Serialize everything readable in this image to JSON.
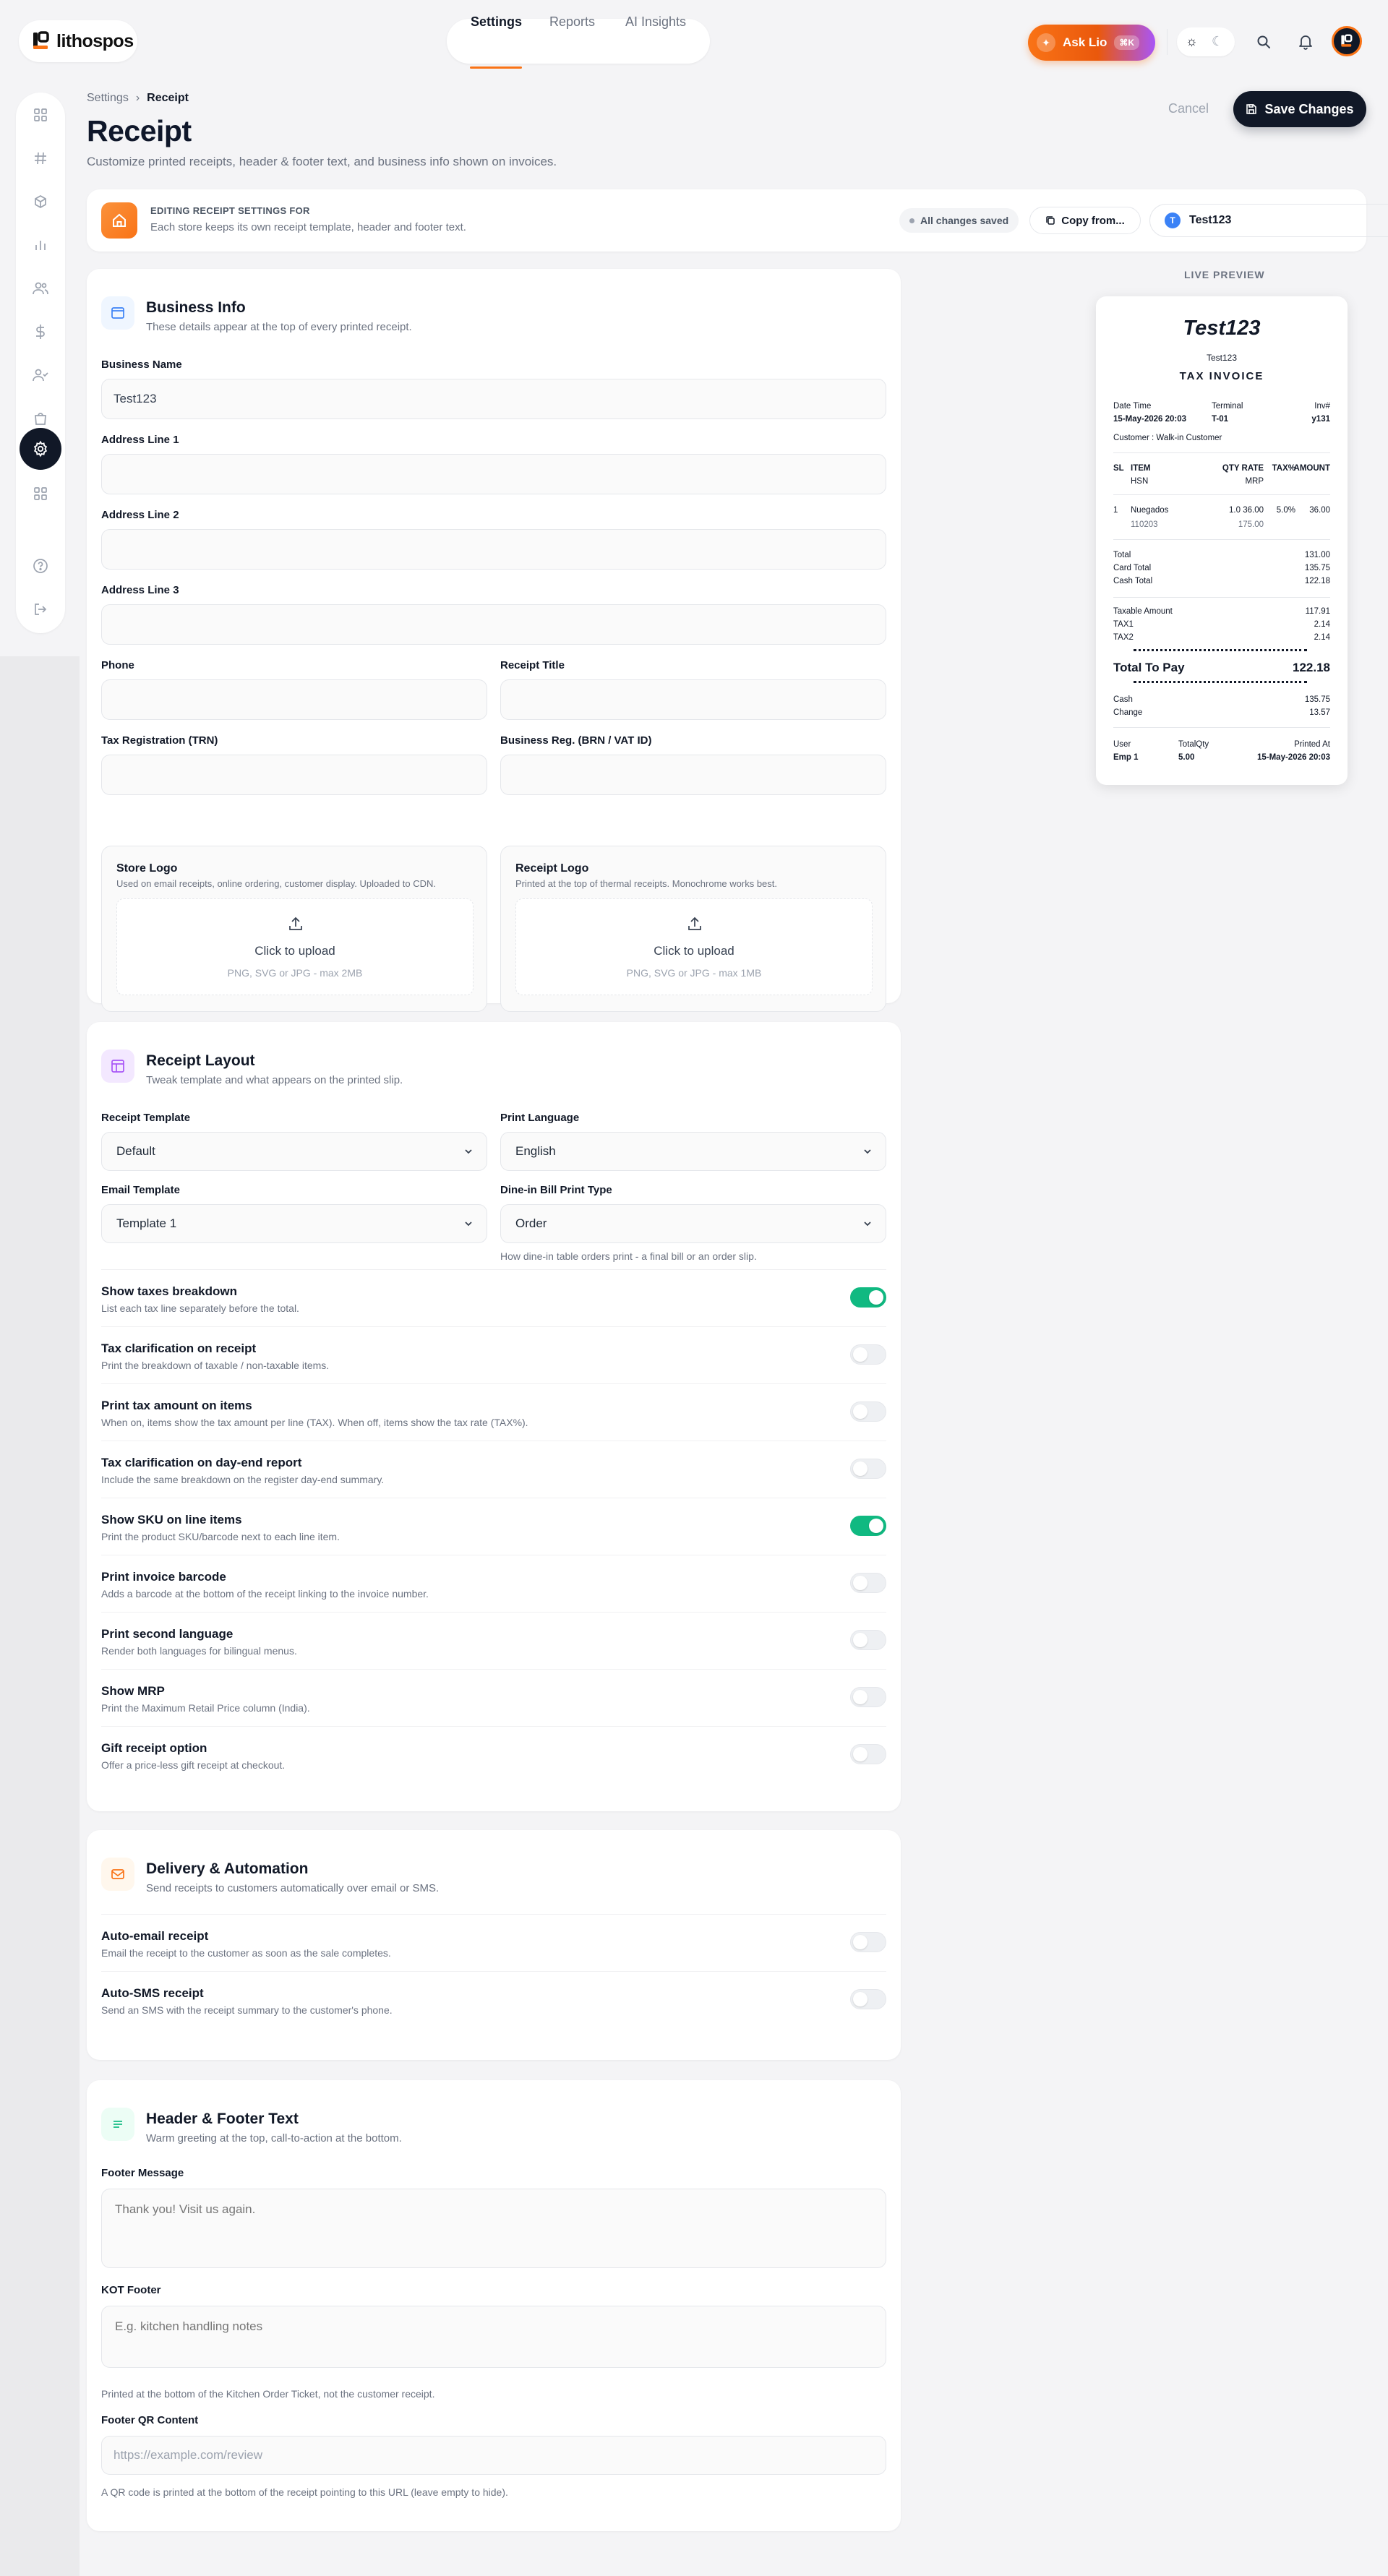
{
  "brand": {
    "name": "lithospos"
  },
  "nav": {
    "tabs": [
      {
        "label": "Settings"
      },
      {
        "label": "Reports"
      },
      {
        "label": "AI Insights"
      }
    ]
  },
  "ask": {
    "label": "Ask Lio",
    "shortcut": "⌘K"
  },
  "breadcrumb": {
    "root": "Settings",
    "current": "Receipt"
  },
  "header": {
    "title": "Receipt",
    "subtitle": "Customize printed receipts, header & footer text, and business info shown on invoices.",
    "cancel": "Cancel",
    "save": "Save Changes"
  },
  "store_bar": {
    "label": "EDITING RECEIPT SETTINGS FOR",
    "desc": "Each store keeps its own receipt template, header and footer text.",
    "saved": "All changes saved",
    "copy": "Copy from...",
    "store_initial": "T",
    "store_name": "Test123"
  },
  "business": {
    "title": "Business Info",
    "subtitle": "These details appear at the top of every printed receipt.",
    "name_label": "Business Name",
    "name_value": "Test123",
    "addr1_label": "Address Line 1",
    "addr2_label": "Address Line 2",
    "addr3_label": "Address Line 3",
    "phone_label": "Phone",
    "receipt_title_label": "Receipt Title",
    "trn_label": "Tax Registration (TRN)",
    "brn_label": "Business Reg. (BRN / VAT ID)",
    "store_logo": {
      "title": "Store Logo",
      "sub": "Used on email receipts, online ordering, customer display. Uploaded to CDN.",
      "cta": "Click to upload",
      "formats": "PNG, SVG or JPG - max 2MB"
    },
    "receipt_logo": {
      "title": "Receipt Logo",
      "sub": "Printed at the top of thermal receipts. Monochrome works best.",
      "cta": "Click to upload",
      "formats": "PNG, SVG or JPG - max 1MB"
    }
  },
  "layout": {
    "title": "Receipt Layout",
    "subtitle": "Tweak template and what appears on the printed slip.",
    "template_label": "Receipt Template",
    "template_value": "Default",
    "language_label": "Print Language",
    "language_value": "English",
    "email_label": "Email Template",
    "email_value": "Template 1",
    "dinein_label": "Dine-in Bill Print Type",
    "dinein_value": "Order",
    "dinein_hint": "How dine-in table orders print - a final bill or an order slip.",
    "toggles": [
      {
        "title": "Show taxes breakdown",
        "sub": "List each tax line separately before the total.",
        "on": true
      },
      {
        "title": "Tax clarification on receipt",
        "sub": "Print the breakdown of taxable / non-taxable items.",
        "on": false
      },
      {
        "title": "Print tax amount on items",
        "sub": "When on, items show the tax amount per line (TAX). When off, items show the tax rate (TAX%).",
        "on": false
      },
      {
        "title": "Tax clarification on day-end report",
        "sub": "Include the same breakdown on the register day-end summary.",
        "on": false
      },
      {
        "title": "Show SKU on line items",
        "sub": "Print the product SKU/barcode next to each line item.",
        "on": true
      },
      {
        "title": "Print invoice barcode",
        "sub": "Adds a barcode at the bottom of the receipt linking to the invoice number.",
        "on": false
      },
      {
        "title": "Print second language",
        "sub": "Render both languages for bilingual menus.",
        "on": false
      },
      {
        "title": "Show MRP",
        "sub": "Print the Maximum Retail Price column (India).",
        "on": false
      },
      {
        "title": "Gift receipt option",
        "sub": "Offer a price-less gift receipt at checkout.",
        "on": false
      }
    ]
  },
  "delivery": {
    "title": "Delivery & Automation",
    "subtitle": "Send receipts to customers automatically over email or SMS.",
    "toggles": [
      {
        "title": "Auto-email receipt",
        "sub": "Email the receipt to the customer as soon as the sale completes.",
        "on": false
      },
      {
        "title": "Auto-SMS receipt",
        "sub": "Send an SMS with the receipt summary to the customer's phone.",
        "on": false
      }
    ]
  },
  "hf": {
    "title": "Header & Footer Text",
    "subtitle": "Warm greeting at the top, call-to-action at the bottom.",
    "footer_label": "Footer Message",
    "footer_placeholder": "Thank you! Visit us again.",
    "kot_label": "KOT Footer",
    "kot_placeholder": "E.g. kitchen handling notes",
    "kot_hint": "Printed at the bottom of the Kitchen Order Ticket, not the customer receipt.",
    "qr_label": "Footer QR Content",
    "qr_placeholder": "https://example.com/review",
    "qr_hint": "A QR code is printed at the bottom of the receipt pointing to this URL (leave empty to hide)."
  },
  "preview": {
    "label": "LIVE PREVIEW",
    "title": "Test123",
    "store": "Test123",
    "doc": "TAX INVOICE",
    "dt_label": "Date Time",
    "dt_value": "15-May-2026 20:03",
    "term_label": "Terminal",
    "term_value": "T-01",
    "inv_label": "Inv#",
    "inv_value": "y131",
    "customer": "Customer : Walk-in Customer",
    "cols": {
      "sl": "SL",
      "item": "ITEM",
      "hsn": "HSN",
      "qty": "QTY RATE",
      "mrp": "MRP",
      "tax": "TAX%",
      "amt": "AMOUNT"
    },
    "row": {
      "sl": "1",
      "name": "Nuegados",
      "sku": "110203",
      "qty": "1.0 36.00",
      "mrp": "175.00",
      "tax": "5.0%",
      "amt": "36.00"
    },
    "totals": [
      {
        "label": "Total",
        "value": "131.00"
      },
      {
        "label": "Card Total",
        "value": "135.75"
      },
      {
        "label": "Cash Total",
        "value": "122.18"
      }
    ],
    "taxes": [
      {
        "label": "Taxable Amount",
        "value": "117.91"
      },
      {
        "label": "TAX1",
        "value": "2.14"
      },
      {
        "label": "TAX2",
        "value": "2.14"
      }
    ],
    "pay_label": "Total To Pay",
    "pay_value": "122.18",
    "cash_label": "Cash",
    "cash_value": "135.75",
    "change_label": "Change",
    "change_value": "13.57",
    "user_label": "User",
    "user_value": "Emp 1",
    "qty_label": "TotalQty",
    "qty_value": "5.00",
    "printed_label": "Printed At",
    "printed_value": "15-May-2026 20:03"
  }
}
